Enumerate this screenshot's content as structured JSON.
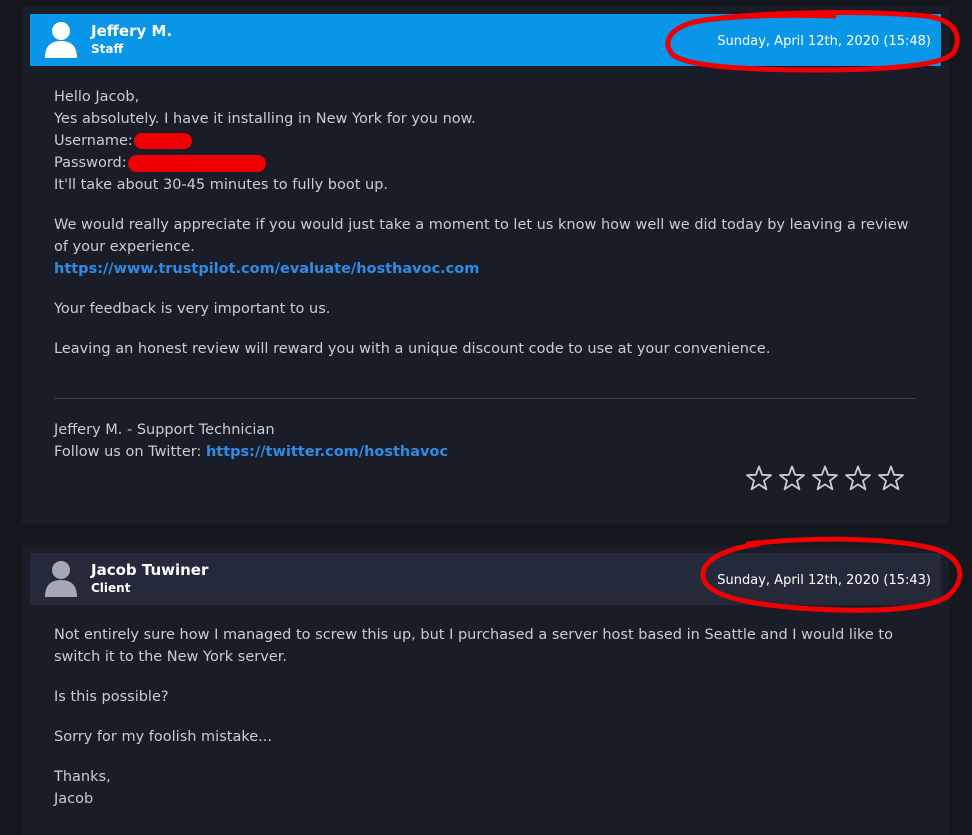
{
  "replies": [
    {
      "author": "Jeffery M.",
      "role": "Staff",
      "date": "Sunday, April 12th, 2020 (15:48)",
      "body": {
        "greeting": "Hello Jacob,",
        "line2": "Yes absolutely. I have it installing in New York for you now.",
        "username_label": "Username:",
        "password_label": "Password:",
        "boot_line": "It'll take about 30-45 minutes to fully boot up.",
        "review_request": "We would really appreciate if you would just take a moment to let us know how well we did today by leaving a review of your experience.",
        "review_link": "https://www.trustpilot.com/evaluate/hosthavoc.com",
        "feedback": "Your feedback is very important to us.",
        "discount": "Leaving an honest review will reward you with a unique discount code to use at your convenience."
      },
      "signature": {
        "line1": "Jeffery M. - Support Technician",
        "twitter_label": "Follow us on Twitter:",
        "twitter_link": "https://twitter.com/hosthavoc"
      },
      "rating": {
        "max": 5,
        "value": 0
      }
    },
    {
      "author": "Jacob Tuwiner",
      "role": "Client",
      "date": "Sunday, April 12th, 2020 (15:43)",
      "body": {
        "p1": "Not entirely sure how I managed to screw this up, but I purchased a server host based in Seattle and I would like to switch it to the New York server.",
        "p2": "Is this possible?",
        "p3": "Sorry for my foolish mistake...",
        "p4_line1": "Thanks,",
        "p4_line2": "Jacob"
      }
    }
  ],
  "colors": {
    "background": "#15171f",
    "card": "#1a1d28",
    "staff_header": "#0a96e8",
    "client_header": "#252a3a",
    "link": "#2e8ce6",
    "annotation": "#f00000"
  },
  "icons": {
    "avatar": "user-silhouette-icon",
    "star": "star-outline-icon"
  }
}
